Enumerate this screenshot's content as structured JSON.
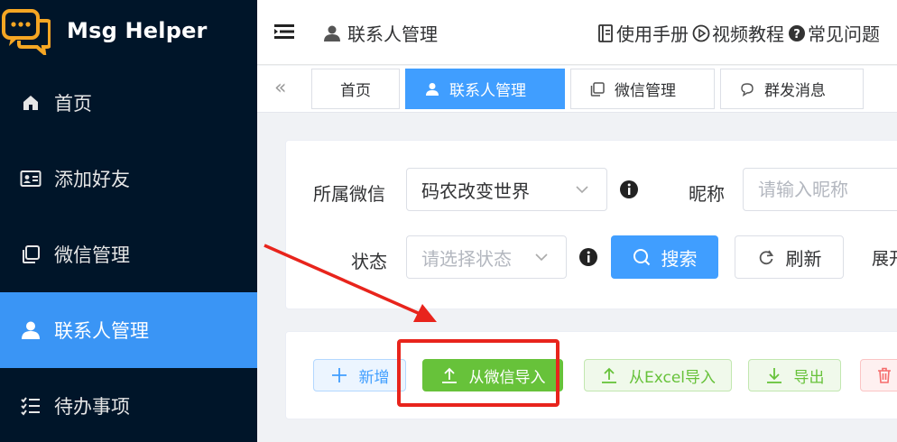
{
  "app": {
    "name": "Msg Helper"
  },
  "sidebar": {
    "items": [
      {
        "label": "首页",
        "icon": "home-icon"
      },
      {
        "label": "添加好友",
        "icon": "id-card-icon"
      },
      {
        "label": "微信管理",
        "icon": "copy-icon"
      },
      {
        "label": "联系人管理",
        "icon": "user-icon",
        "active": true
      },
      {
        "label": "待办事项",
        "icon": "checklist-icon"
      }
    ]
  },
  "header": {
    "breadcrumb": "联系人管理",
    "links": [
      {
        "label": "使用手册",
        "icon": "manual-icon"
      },
      {
        "label": "视频教程",
        "icon": "play-circle-icon"
      },
      {
        "label": "常见问题",
        "icon": "question-circle-icon"
      }
    ]
  },
  "tabs": [
    {
      "label": "首页"
    },
    {
      "label": "联系人管理",
      "active": true
    },
    {
      "label": "微信管理"
    },
    {
      "label": "群发消息"
    }
  ],
  "filters": {
    "wechat_label": "所属微信",
    "wechat_value": "码农改变世界",
    "nickname_label": "昵称",
    "nickname_placeholder": "请输入昵称",
    "status_label": "状态",
    "status_placeholder": "请选择状态",
    "search_label": "搜索",
    "refresh_label": "刷新",
    "expand_label": "展开"
  },
  "actions": {
    "new_label": "新增",
    "import_wechat_label": "从微信导入",
    "import_excel_label": "从Excel导入",
    "export_label": "导出"
  },
  "colors": {
    "sidebar_bg": "#001529",
    "accent": "#409eff",
    "active_menu": "#3a95f5",
    "success": "#67c23a",
    "annotation": "#e8241c"
  }
}
